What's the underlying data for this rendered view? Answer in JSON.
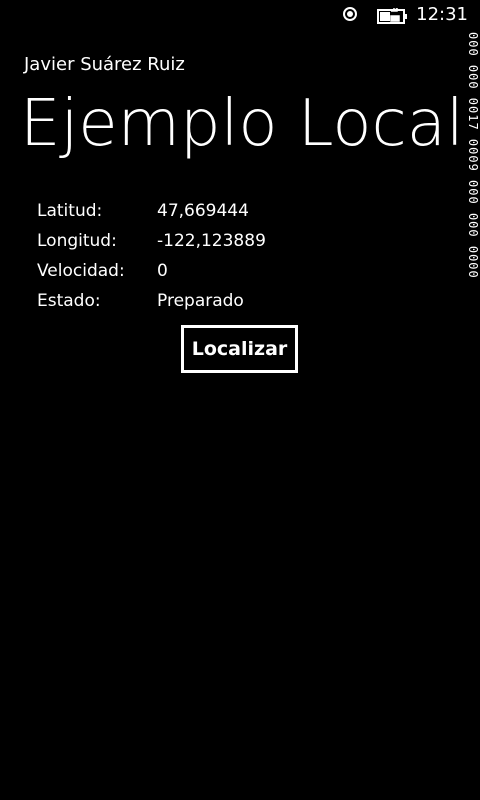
{
  "status_bar": {
    "time": "12:31",
    "icons": [
      "location-icon",
      "battery-charging-icon"
    ]
  },
  "frame_counter": {
    "text": "000 000 0017 0009 000 000 0000"
  },
  "header": {
    "app_name": "Javier Suárez Ruiz",
    "page_title": "Ejemplo Localización"
  },
  "fields": [
    {
      "label": "Latitud:",
      "value": "47,669444"
    },
    {
      "label": "Longitud:",
      "value": "-122,123889"
    },
    {
      "label": "Velocidad:",
      "value": "0"
    },
    {
      "label": "Estado:",
      "value": "Preparado"
    }
  ],
  "actions": {
    "locate_label": "Localizar"
  },
  "colors": {
    "background": "#000000",
    "foreground": "#ffffff",
    "counter_accent": "#e85a45"
  }
}
